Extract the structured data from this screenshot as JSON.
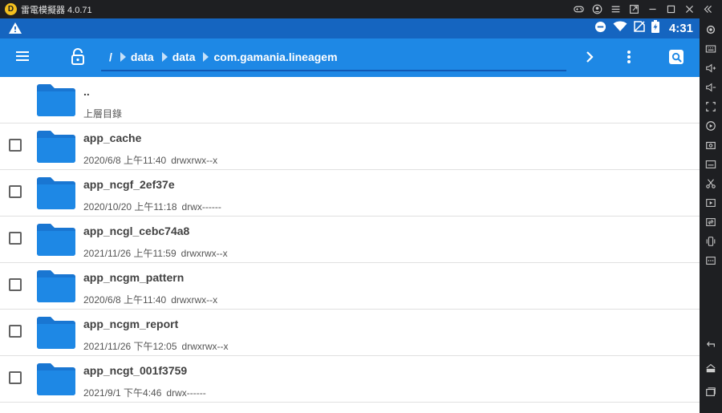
{
  "window": {
    "title": "雷電模擬器 4.0.71",
    "logo_letter": "D"
  },
  "statusbar": {
    "clock": "4:31"
  },
  "appbar": {
    "root": "/",
    "breadcrumbs": [
      "data",
      "data",
      "com.gamania.lineagem"
    ]
  },
  "files": [
    {
      "name": "..",
      "date": "上層目錄",
      "perm": "",
      "checkbox": false
    },
    {
      "name": "app_cache",
      "date": "2020/6/8 上午11:40",
      "perm": "drwxrwx--x",
      "checkbox": true
    },
    {
      "name": "app_ncgf_2ef37e",
      "date": "2020/10/20 上午11:18",
      "perm": "drwx------",
      "checkbox": true
    },
    {
      "name": "app_ncgl_cebc74a8",
      "date": "2021/11/26 上午11:59",
      "perm": "drwxrwx--x",
      "checkbox": true
    },
    {
      "name": "app_ncgm_pattern",
      "date": "2020/6/8 上午11:40",
      "perm": "drwxrwx--x",
      "checkbox": true
    },
    {
      "name": "app_ncgm_report",
      "date": "2021/11/26 下午12:05",
      "perm": "drwxrwx--x",
      "checkbox": true
    },
    {
      "name": "app_ncgt_001f3759",
      "date": "2021/9/1 下午4:46",
      "perm": "drwx------",
      "checkbox": true
    }
  ],
  "colors": {
    "statusbar": "#1565c0",
    "appbar": "#1e88e5",
    "folder": "#1976d2",
    "emulator_chrome": "#1e1f22"
  }
}
